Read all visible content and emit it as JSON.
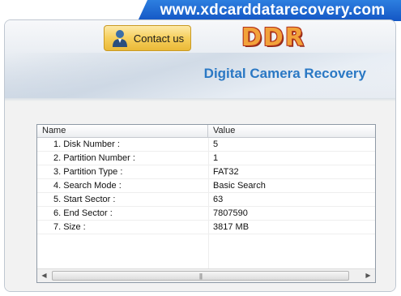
{
  "banner": {
    "url": "www.xdcarddatarecovery.com"
  },
  "header": {
    "contact_label": "Contact us",
    "logo_text": "DDR",
    "subtitle": "Digital Camera Recovery"
  },
  "list": {
    "columns": [
      "Name",
      "Value"
    ],
    "rows": [
      {
        "name": "1. Disk Number :",
        "value": "5"
      },
      {
        "name": "2. Partition Number :",
        "value": "1"
      },
      {
        "name": "3. Partition Type :",
        "value": "FAT32"
      },
      {
        "name": "4. Search Mode :",
        "value": "Basic Search"
      },
      {
        "name": "5. Start Sector :",
        "value": "63"
      },
      {
        "name": "6. End Sector :",
        "value": "7807590"
      },
      {
        "name": "7. Size :",
        "value": "3817 MB"
      }
    ]
  },
  "scrollbar": {
    "left_arrow": "◀",
    "right_arrow": "▶",
    "grip": "|||"
  }
}
